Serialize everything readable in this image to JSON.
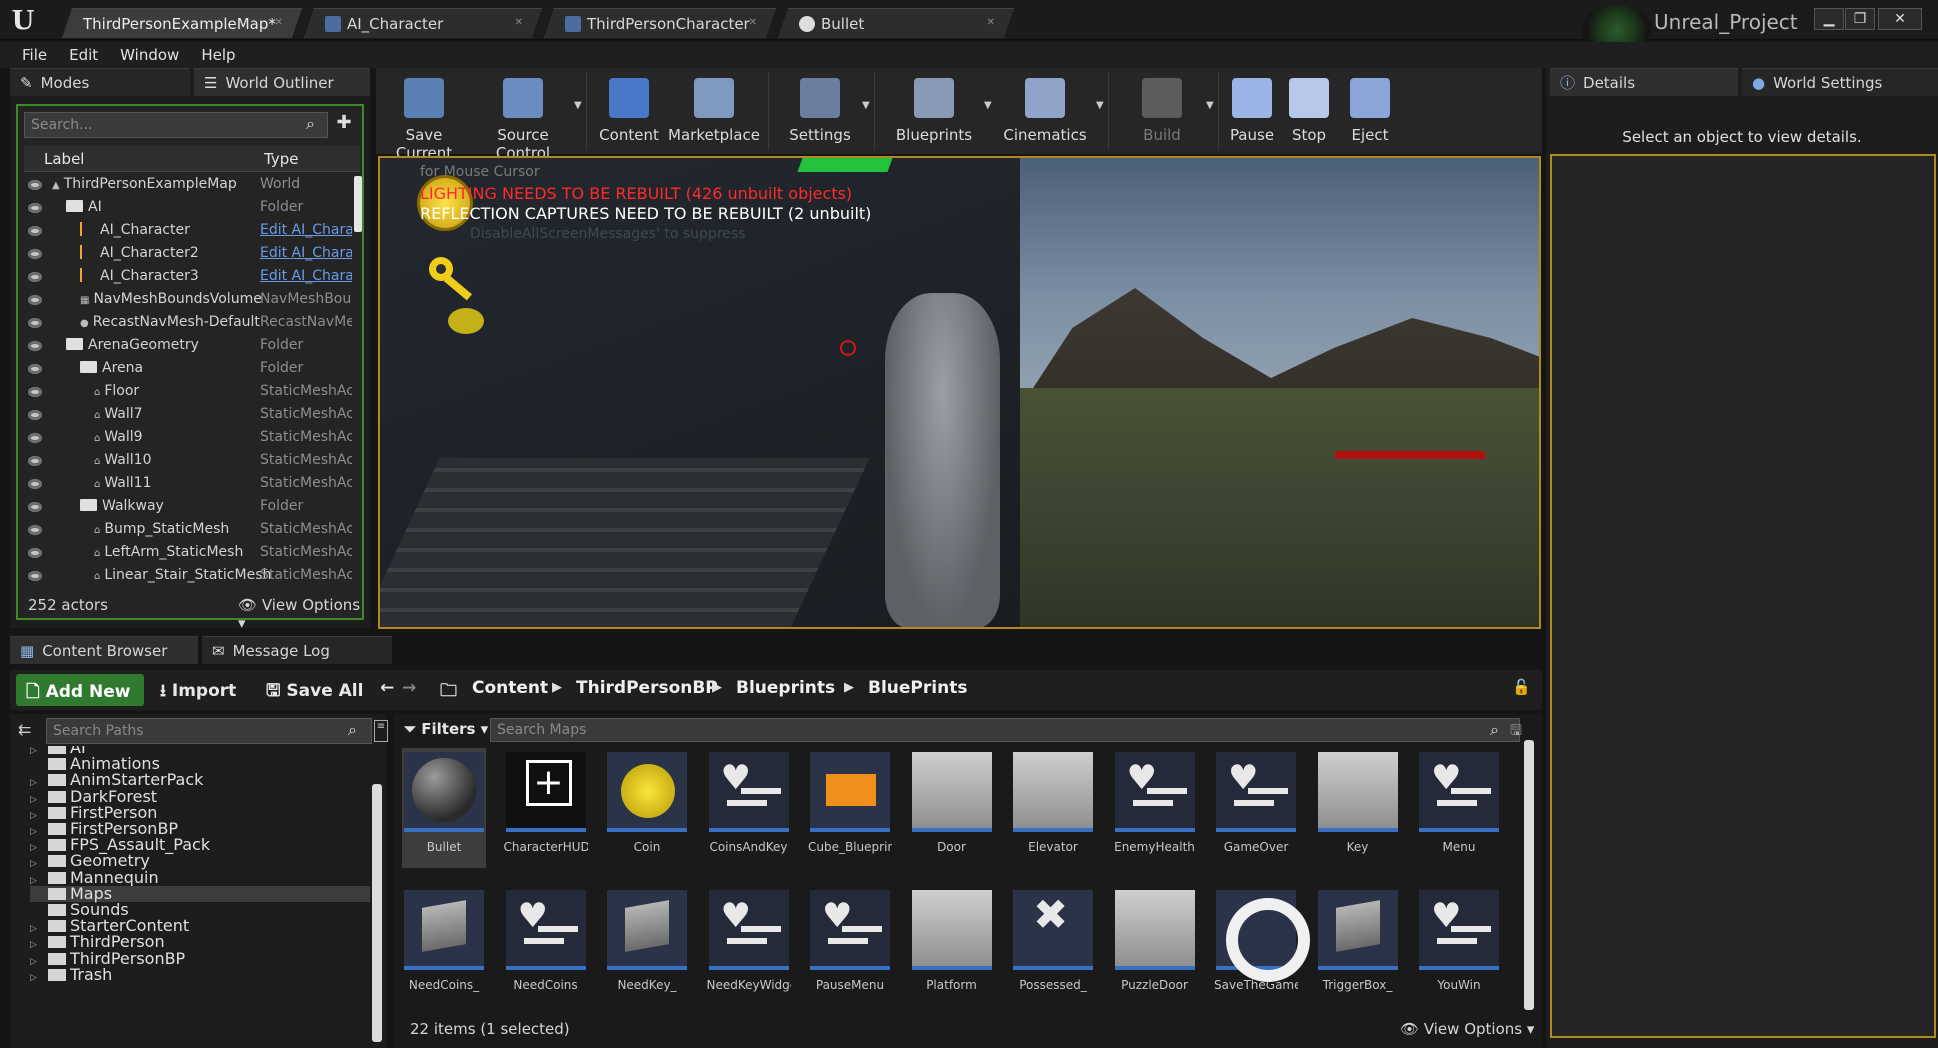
{
  "titlebar": {
    "tabs": [
      {
        "label": "ThirdPersonExampleMap*"
      },
      {
        "label": "AI_Character"
      },
      {
        "label": "ThirdPersonCharacter"
      },
      {
        "label": "Bullet"
      }
    ],
    "project_name": "Unreal_Project",
    "logo": "U"
  },
  "menu": [
    "File",
    "Edit",
    "Window",
    "Help"
  ],
  "left_panel": {
    "tabs": [
      "Modes",
      "World Outliner"
    ],
    "search_placeholder": "Search...",
    "columns": {
      "label": "Label",
      "type": "Type"
    },
    "rows": [
      {
        "label": "ThirdPersonExampleMap",
        "type": "World",
        "indent": 0,
        "icon": "world",
        "link": false
      },
      {
        "label": "AI",
        "type": "Folder",
        "indent": 1,
        "icon": "folder",
        "link": false
      },
      {
        "label": "AI_Character",
        "type": "Edit AI_Character",
        "indent": 2,
        "icon": "actor",
        "link": true
      },
      {
        "label": "AI_Character2",
        "type": "Edit AI_Character",
        "indent": 2,
        "icon": "actor",
        "link": true
      },
      {
        "label": "AI_Character3",
        "type": "Edit AI_Character",
        "indent": 2,
        "icon": "actor",
        "link": true
      },
      {
        "label": "NavMeshBoundsVolume",
        "type": "NavMeshBoundsVolume",
        "indent": 2,
        "icon": "nav",
        "link": false
      },
      {
        "label": "RecastNavMesh-Default",
        "type": "RecastNavMesh",
        "indent": 2,
        "icon": "sphere",
        "link": false
      },
      {
        "label": "ArenaGeometry",
        "type": "Folder",
        "indent": 1,
        "icon": "folder",
        "link": false
      },
      {
        "label": "Arena",
        "type": "Folder",
        "indent": 2,
        "icon": "folder",
        "link": false
      },
      {
        "label": "Floor",
        "type": "StaticMeshActor",
        "indent": 3,
        "icon": "mesh",
        "link": false
      },
      {
        "label": "Wall7",
        "type": "StaticMeshActor",
        "indent": 3,
        "icon": "mesh",
        "link": false
      },
      {
        "label": "Wall9",
        "type": "StaticMeshActor",
        "indent": 3,
        "icon": "mesh",
        "link": false
      },
      {
        "label": "Wall10",
        "type": "StaticMeshActor",
        "indent": 3,
        "icon": "mesh",
        "link": false
      },
      {
        "label": "Wall11",
        "type": "StaticMeshActor",
        "indent": 3,
        "icon": "mesh",
        "link": false
      },
      {
        "label": "Walkway",
        "type": "Folder",
        "indent": 2,
        "icon": "folder",
        "link": false
      },
      {
        "label": "Bump_StaticMesh",
        "type": "StaticMeshActor",
        "indent": 3,
        "icon": "mesh",
        "link": false
      },
      {
        "label": "LeftArm_StaticMesh",
        "type": "StaticMeshActor",
        "indent": 3,
        "icon": "mesh",
        "link": false
      },
      {
        "label": "Linear_Stair_StaticMesh",
        "type": "StaticMeshActor",
        "indent": 3,
        "icon": "mesh",
        "link": false
      }
    ],
    "actor_count": "252 actors",
    "view_options": "View Options"
  },
  "toolbar": [
    {
      "label": "Save Current",
      "icon": "save-icon",
      "dropdown": false,
      "enabled": true
    },
    {
      "label": "Source Control",
      "icon": "source-control-icon",
      "dropdown": true,
      "enabled": true
    },
    {
      "label": "Content",
      "icon": "content-icon",
      "dropdown": false,
      "enabled": true
    },
    {
      "label": "Marketplace",
      "icon": "marketplace-icon",
      "dropdown": false,
      "enabled": true
    },
    {
      "label": "Settings",
      "icon": "settings-icon",
      "dropdown": true,
      "enabled": true
    },
    {
      "label": "Blueprints",
      "icon": "blueprints-icon",
      "dropdown": true,
      "enabled": true
    },
    {
      "label": "Cinematics",
      "icon": "cinematics-icon",
      "dropdown": true,
      "enabled": true
    },
    {
      "label": "Build",
      "icon": "build-icon",
      "dropdown": true,
      "enabled": false
    },
    {
      "label": "Pause",
      "icon": "pause-icon",
      "dropdown": false,
      "enabled": true
    },
    {
      "label": "Stop",
      "icon": "stop-icon",
      "dropdown": false,
      "enabled": true
    },
    {
      "label": "Eject",
      "icon": "eject-icon",
      "dropdown": false,
      "enabled": true
    }
  ],
  "viewport": {
    "msg_mouse": "for Mouse Cursor",
    "msg_lighting": "LIGHTING NEEDS TO BE REBUILT (426 unbuilt objects)",
    "msg_reflection": "REFLECTION CAPTURES NEED TO BE REBUILT (2 unbuilt)",
    "msg_hidden": "DisableAllScreenMessages' to suppress"
  },
  "details": {
    "tabs": [
      "Details",
      "World Settings"
    ],
    "hint": "Select an object to view details."
  },
  "content_browser": {
    "tabs": [
      "Content Browser",
      "Message Log"
    ],
    "add_new": "Add New",
    "import": "Import",
    "save_all": "Save All",
    "breadcrumb": [
      "Content",
      "ThirdPersonBP",
      "Blueprints",
      "BluePrints"
    ],
    "path_search_placeholder": "Search Paths",
    "paths": [
      {
        "label": "AI",
        "expandable": true,
        "selected": false
      },
      {
        "label": "Animations",
        "expandable": false,
        "selected": false
      },
      {
        "label": "AnimStarterPack",
        "expandable": true,
        "selected": false
      },
      {
        "label": "DarkForest",
        "expandable": true,
        "selected": false
      },
      {
        "label": "FirstPerson",
        "expandable": true,
        "selected": false
      },
      {
        "label": "FirstPersonBP",
        "expandable": true,
        "selected": false
      },
      {
        "label": "FPS_Assault_Pack",
        "expandable": true,
        "selected": false
      },
      {
        "label": "Geometry",
        "expandable": true,
        "selected": false
      },
      {
        "label": "Mannequin",
        "expandable": true,
        "selected": false
      },
      {
        "label": "Maps",
        "expandable": false,
        "selected": true
      },
      {
        "label": "Sounds",
        "expandable": false,
        "selected": false
      },
      {
        "label": "StarterContent",
        "expandable": true,
        "selected": false
      },
      {
        "label": "ThirdPerson",
        "expandable": true,
        "selected": false
      },
      {
        "label": "ThirdPersonBP",
        "expandable": true,
        "selected": false
      },
      {
        "label": "Trash",
        "expandable": true,
        "selected": false
      }
    ],
    "filters": "Filters",
    "search_placeholder": "Search Maps",
    "assets": [
      {
        "name": "Bullet",
        "thumb": "sphere",
        "selected": true
      },
      {
        "name": "CharacterHUD",
        "thumb": "hud",
        "selected": false
      },
      {
        "name": "Coin",
        "thumb": "coin",
        "selected": false
      },
      {
        "name": "CoinsAndKey",
        "thumb": "heart",
        "selected": false
      },
      {
        "name": "Cube_Blueprint",
        "thumb": "orange",
        "selected": false
      },
      {
        "name": "Door",
        "thumb": "grey",
        "selected": false
      },
      {
        "name": "Elevator",
        "thumb": "grey",
        "selected": false
      },
      {
        "name": "EnemyHealth",
        "thumb": "heart",
        "selected": false
      },
      {
        "name": "GameOver",
        "thumb": "heart",
        "selected": false
      },
      {
        "name": "Key",
        "thumb": "grey",
        "selected": false
      },
      {
        "name": "Menu",
        "thumb": "heart",
        "selected": false
      },
      {
        "name": "NeedCoins_",
        "thumb": "cube",
        "selected": false
      },
      {
        "name": "NeedCoins",
        "thumb": "heart",
        "selected": false
      },
      {
        "name": "NeedKey_",
        "thumb": "cube",
        "selected": false
      },
      {
        "name": "NeedKeyWidget",
        "thumb": "heart",
        "selected": false
      },
      {
        "name": "PauseMenu",
        "thumb": "heart",
        "selected": false
      },
      {
        "name": "Platform",
        "thumb": "grey",
        "selected": false
      },
      {
        "name": "Possessed_",
        "thumb": "cross",
        "selected": false
      },
      {
        "name": "PuzzleDoor",
        "thumb": "grey",
        "selected": false
      },
      {
        "name": "SaveTheGame",
        "thumb": "ring",
        "selected": false
      },
      {
        "name": "TriggerBox_",
        "thumb": "cube",
        "selected": false
      },
      {
        "name": "YouWin",
        "thumb": "heart",
        "selected": false
      }
    ],
    "item_count": "22 items (1 selected)",
    "view_options": "View Options"
  }
}
